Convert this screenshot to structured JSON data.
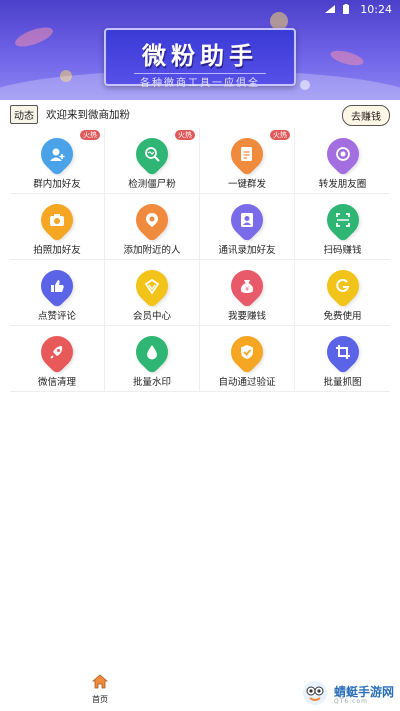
{
  "status_bar": {
    "time": "10:24"
  },
  "banner": {
    "title": "微粉助手",
    "subtitle": "各种微商工具一应俱全"
  },
  "notice": {
    "tag": "动态",
    "text": "欢迎来到微商加粉",
    "earn_label": "去赚钱"
  },
  "hot_label": "火热",
  "tools": [
    {
      "label": "群内加好友",
      "icon": "group-add-icon",
      "color": "#4aa3e8",
      "hot": true
    },
    {
      "label": "检测僵尸粉",
      "icon": "detect-icon",
      "color": "#2fb574",
      "hot": true
    },
    {
      "label": "一键群发",
      "icon": "broadcast-icon",
      "color": "#f08a3c",
      "hot": true
    },
    {
      "label": "转发朋友圈",
      "icon": "moments-icon",
      "color": "#a36ee0",
      "hot": false
    },
    {
      "label": "拍照加好友",
      "icon": "camera-icon",
      "color": "#f5a623",
      "hot": false
    },
    {
      "label": "添加附近的人",
      "icon": "location-icon",
      "color": "#f08a3c",
      "hot": false
    },
    {
      "label": "通讯录加好友",
      "icon": "contacts-icon",
      "color": "#7a6ce8",
      "hot": false
    },
    {
      "label": "扫码赚钱",
      "icon": "scan-icon",
      "color": "#2fb574",
      "hot": false
    },
    {
      "label": "点赞评论",
      "icon": "thumb-up-icon",
      "color": "#5b63e6",
      "hot": false
    },
    {
      "label": "会员中心",
      "icon": "member-icon",
      "color": "#f2c318",
      "hot": false
    },
    {
      "label": "我要赚钱",
      "icon": "money-bag-icon",
      "color": "#e85a6a",
      "hot": false
    },
    {
      "label": "免费使用",
      "icon": "free-icon",
      "color": "#f2c318",
      "hot": false
    },
    {
      "label": "微信清理",
      "icon": "rocket-icon",
      "color": "#e85a5a",
      "hot": false
    },
    {
      "label": "批量水印",
      "icon": "water-drop-icon",
      "color": "#2fb574",
      "hot": false
    },
    {
      "label": "自动通过验证",
      "icon": "shield-check-icon",
      "color": "#f5a623",
      "hot": false
    },
    {
      "label": "批量抓图",
      "icon": "crop-icon",
      "color": "#5b63e6",
      "hot": false
    }
  ],
  "bottom_nav": {
    "home_label": "首页"
  },
  "watermark": {
    "text": "蜻蜓手游网",
    "sub": "QT6.com"
  }
}
